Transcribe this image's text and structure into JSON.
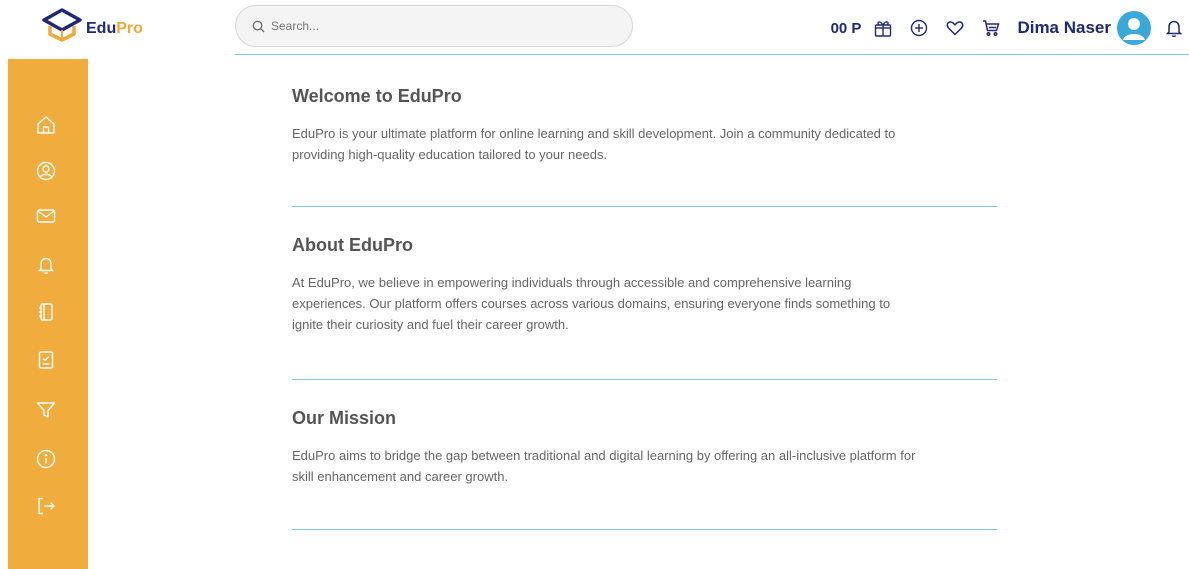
{
  "brand": {
    "part1": "Edu",
    "part2": "Pro"
  },
  "search": {
    "placeholder": "Search..."
  },
  "header": {
    "points": "00 P",
    "user_name": "Dima Naser",
    "icons": [
      "gift-icon",
      "add-circle-icon",
      "heart-icon",
      "cart-icon",
      "avatar",
      "bell-icon"
    ]
  },
  "sidebar": {
    "items": [
      "home-icon",
      "profile-icon",
      "mail-icon",
      "notifications-icon",
      "courses-icon",
      "tasks-icon",
      "filter-icon",
      "info-icon",
      "logout-icon"
    ]
  },
  "sections": [
    {
      "title": "Welcome to EduPro",
      "body": "EduPro is your ultimate platform for online learning and skill development. Join a community dedicated to providing high-quality education tailored to your needs."
    },
    {
      "title": "About EduPro",
      "body": "At EduPro, we believe in empowering individuals through accessible and comprehensive learning experiences. Our platform offers courses across various domains, ensuring everyone finds something to ignite their curiosity and fuel their career growth."
    },
    {
      "title": "Our Mission",
      "body": "EduPro aims to bridge the gap between traditional and digital learning by offering an all-inclusive platform for skill enhancement and career growth."
    }
  ],
  "colors": {
    "brand_navy": "#1e2a78",
    "brand_orange": "#f0a93a",
    "sidebar": "#f0ad3e",
    "divider": "#7fc9d9"
  }
}
